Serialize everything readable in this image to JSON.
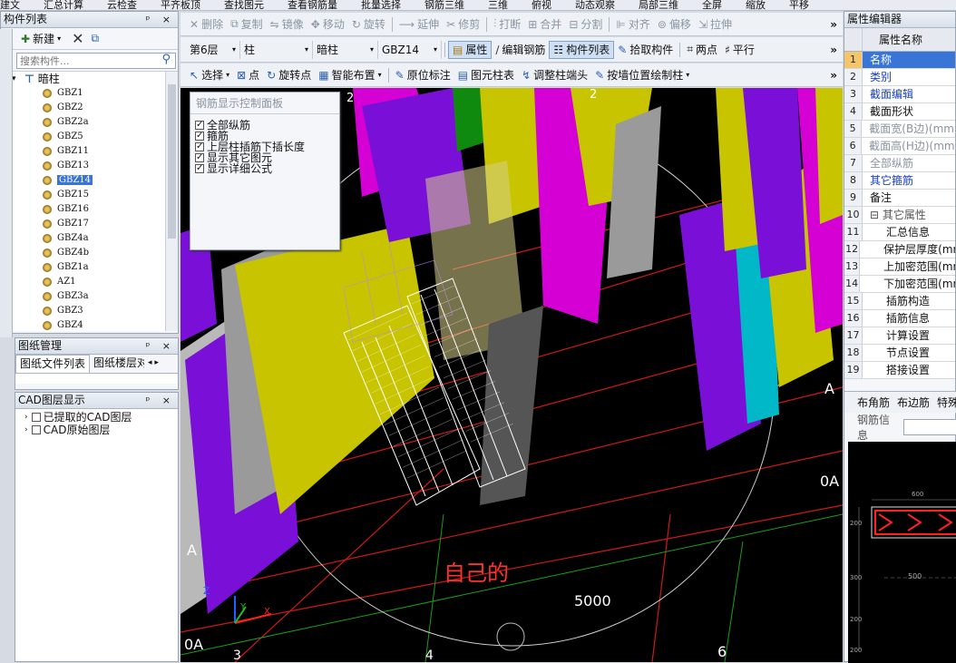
{
  "top_strip": [
    "建文",
    "汇总计算",
    "云检查",
    "平齐板顶",
    "查找图元",
    "查看钢筋量",
    "批量选择",
    "钢筋三维",
    "三维",
    "俯视",
    "动态观察",
    "局部三维",
    "全屏",
    "缩放",
    "平移"
  ],
  "component_list": {
    "title": "构件列表",
    "new_label": "新建",
    "search_placeholder": "搜索构件...",
    "category": "暗柱",
    "items": [
      "GBZ1",
      "GBZ2",
      "GBZ2a",
      "GBZ5",
      "GBZ11",
      "GBZ13",
      "GBZ14",
      "GBZ15",
      "GBZ16",
      "GBZ17",
      "GBZ4a",
      "GBZ4b",
      "GBZ1a",
      "AZ1",
      "GBZ3a",
      "GBZ3",
      "GBZ4"
    ],
    "selected": "GBZ14"
  },
  "drawing_mgmt": {
    "title": "图纸管理",
    "tabs": [
      "图纸文件列表",
      "图纸楼层对"
    ]
  },
  "cad_layers": {
    "title": "CAD图层显示",
    "items": [
      "已提取的CAD图层",
      "CAD原始图层"
    ]
  },
  "toolbar1": [
    "删除",
    "复制",
    "镜像",
    "移动",
    "旋转",
    "延伸",
    "修剪",
    "打断",
    "合并",
    "分割",
    "对齐",
    "偏移",
    "拉伸"
  ],
  "toolbar2": {
    "floor": "第6层",
    "type": "柱",
    "subtype": "暗柱",
    "component": "GBZ14",
    "buttons": [
      "属性",
      "编辑钢筋",
      "构件列表",
      "拾取构件",
      "两点",
      "平行"
    ]
  },
  "toolbar3": [
    "选择",
    "点",
    "旋转点",
    "智能布置",
    "原位标注",
    "图元柱表",
    "调整柱端头",
    "按墙位置绘制柱"
  ],
  "rebar_panel": {
    "title": "钢筋显示控制面板",
    "options": [
      "全部纵筋",
      "箍筋",
      "上层柱插筋下插长度",
      "显示其它图元",
      "显示详细公式"
    ]
  },
  "viewport": {
    "annotation": "自己的",
    "dimension": "5000",
    "axis_labels": [
      "2",
      "2",
      "A",
      "A",
      "0A",
      "0A",
      "3",
      "4",
      "6"
    ]
  },
  "property_editor": {
    "title": "属性编辑器",
    "column": "属性名称",
    "rows": [
      {
        "n": "1",
        "name": "名称",
        "style": "selected"
      },
      {
        "n": "2",
        "name": "类别",
        "style": "blue"
      },
      {
        "n": "3",
        "name": "截面编辑",
        "style": "blue"
      },
      {
        "n": "4",
        "name": "截面形状",
        "style": "normal"
      },
      {
        "n": "5",
        "name": "截面宽(B边)(mm)",
        "style": "gray"
      },
      {
        "n": "6",
        "name": "截面高(H边)(mm)",
        "style": "gray"
      },
      {
        "n": "7",
        "name": "全部纵筋",
        "style": "gray"
      },
      {
        "n": "8",
        "name": "其它箍筋",
        "style": "blue"
      },
      {
        "n": "9",
        "name": "备注",
        "style": "normal"
      },
      {
        "n": "10",
        "name": "其它属性",
        "style": "group"
      },
      {
        "n": "11",
        "name": "汇总信息",
        "style": "child"
      },
      {
        "n": "12",
        "name": "保护层厚度(mm)",
        "style": "child"
      },
      {
        "n": "13",
        "name": "上加密范围(mm)",
        "style": "child"
      },
      {
        "n": "14",
        "name": "下加密范围(mm)",
        "style": "child"
      },
      {
        "n": "15",
        "name": "插筋构造",
        "style": "child"
      },
      {
        "n": "16",
        "name": "插筋信息",
        "style": "child"
      },
      {
        "n": "17",
        "name": "计算设置",
        "style": "child"
      },
      {
        "n": "18",
        "name": "节点设置",
        "style": "child"
      },
      {
        "n": "19",
        "name": "搭接设置",
        "style": "child"
      }
    ],
    "rebar_tabs": [
      "布角筋",
      "布边筋",
      "特殊"
    ],
    "rebar_info_label": "钢筋信息",
    "section_dims": [
      "600",
      "200",
      "300",
      "200",
      "500",
      "200"
    ]
  },
  "colors": {
    "accent": "#3875d7",
    "viewport_bg": "#000000",
    "purple": "#7a10d8",
    "yellow": "#c8c400",
    "magenta": "#d400d4",
    "annotation": "#ff3030"
  }
}
